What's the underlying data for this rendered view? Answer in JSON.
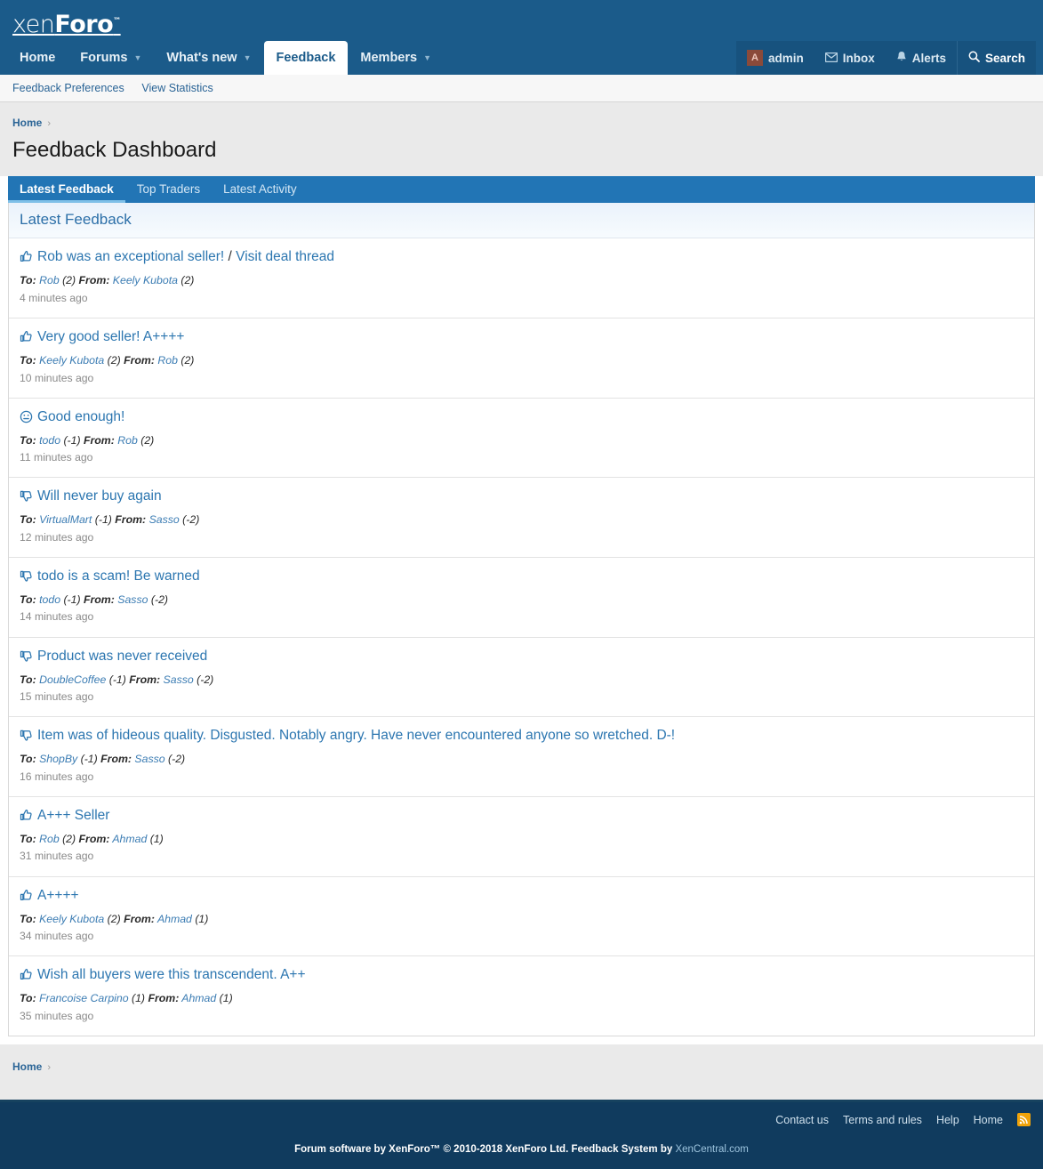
{
  "header": {
    "logo_pre": "xen",
    "logo_bold": "Foro",
    "logo_tm": "™",
    "nav": [
      {
        "label": "Home",
        "caret": false,
        "active": false
      },
      {
        "label": "Forums",
        "caret": true,
        "active": false
      },
      {
        "label": "What's new",
        "caret": true,
        "active": false
      },
      {
        "label": "Feedback",
        "caret": false,
        "active": true
      },
      {
        "label": "Members",
        "caret": true,
        "active": false
      }
    ],
    "account": {
      "avatar_letter": "A",
      "username": "admin",
      "inbox": "Inbox",
      "alerts": "Alerts",
      "search": "Search"
    }
  },
  "subnav": [
    {
      "label": "Feedback Preferences"
    },
    {
      "label": "View Statistics"
    }
  ],
  "page": {
    "breadcrumb_home": "Home",
    "breadcrumb_sep": "›",
    "title": "Feedback Dashboard"
  },
  "tabs": [
    {
      "label": "Latest Feedback",
      "active": true
    },
    {
      "label": "Top Traders",
      "active": false
    },
    {
      "label": "Latest Activity",
      "active": false
    }
  ],
  "block": {
    "heading": "Latest Feedback"
  },
  "labels": {
    "to": "To:",
    "from": "From:"
  },
  "feedback": [
    {
      "icon": "thumbs-up-icon",
      "title": "Rob was an exceptional seller!",
      "extra_sep": " / ",
      "extra_link": "Visit deal thread",
      "to_user": "Rob",
      "to_score": "(2)",
      "from_user": "Keely Kubota",
      "from_score": "(2)",
      "time": "4 minutes ago"
    },
    {
      "icon": "thumbs-up-icon",
      "title": "Very good seller! A++++",
      "extra_sep": "",
      "extra_link": "",
      "to_user": "Keely Kubota",
      "to_score": "(2)",
      "from_user": "Rob",
      "from_score": "(2)",
      "time": "10 minutes ago"
    },
    {
      "icon": "neutral-face-icon",
      "title": "Good enough!",
      "extra_sep": "",
      "extra_link": "",
      "to_user": "todo",
      "to_score": "(-1)",
      "from_user": "Rob",
      "from_score": "(2)",
      "time": "11 minutes ago"
    },
    {
      "icon": "thumbs-down-icon",
      "title": "Will never buy again",
      "extra_sep": "",
      "extra_link": "",
      "to_user": "VirtualMart",
      "to_score": "(-1)",
      "from_user": "Sasso",
      "from_score": "(-2)",
      "time": "12 minutes ago"
    },
    {
      "icon": "thumbs-down-icon",
      "title": "todo is a scam! Be warned",
      "extra_sep": "",
      "extra_link": "",
      "to_user": "todo",
      "to_score": "(-1)",
      "from_user": "Sasso",
      "from_score": "(-2)",
      "time": "14 minutes ago"
    },
    {
      "icon": "thumbs-down-icon",
      "title": "Product was never received",
      "extra_sep": "",
      "extra_link": "",
      "to_user": "DoubleCoffee",
      "to_score": "(-1)",
      "from_user": "Sasso",
      "from_score": "(-2)",
      "time": "15 minutes ago"
    },
    {
      "icon": "thumbs-down-icon",
      "title": "Item was of hideous quality. Disgusted. Notably angry. Have never encountered anyone so wretched. D-!",
      "extra_sep": "",
      "extra_link": "",
      "to_user": "ShopBy",
      "to_score": "(-1)",
      "from_user": "Sasso",
      "from_score": "(-2)",
      "time": "16 minutes ago"
    },
    {
      "icon": "thumbs-up-icon",
      "title": "A+++ Seller",
      "extra_sep": "",
      "extra_link": "",
      "to_user": "Rob",
      "to_score": "(2)",
      "from_user": "Ahmad",
      "from_score": "(1)",
      "time": "31 minutes ago"
    },
    {
      "icon": "thumbs-up-icon",
      "title": "A++++",
      "extra_sep": "",
      "extra_link": "",
      "to_user": "Keely Kubota",
      "to_score": "(2)",
      "from_user": "Ahmad",
      "from_score": "(1)",
      "time": "34 minutes ago"
    },
    {
      "icon": "thumbs-up-icon",
      "title": "Wish all buyers were this transcendent. A++",
      "extra_sep": "",
      "extra_link": "",
      "to_user": "Francoise Carpino",
      "to_score": "(1)",
      "from_user": "Ahmad",
      "from_score": "(1)",
      "time": "35 minutes ago"
    }
  ],
  "footer": {
    "links": [
      {
        "label": "Contact us"
      },
      {
        "label": "Terms and rules"
      },
      {
        "label": "Help"
      },
      {
        "label": "Home"
      }
    ],
    "rss_icon": "rss-icon",
    "copyright_pre": "Forum software by XenForo™ © 2010-2018 XenForo Ltd. Feedback System by ",
    "copyright_link": "XenCentral.com"
  },
  "colors": {
    "header_blue": "#1b5b8a",
    "tabbar_blue": "#2275b5",
    "footer_navy": "#103b5e",
    "link_blue": "#2c76b0",
    "avatar_brown": "#8a4a3a",
    "rss_orange": "#f0a30a"
  }
}
